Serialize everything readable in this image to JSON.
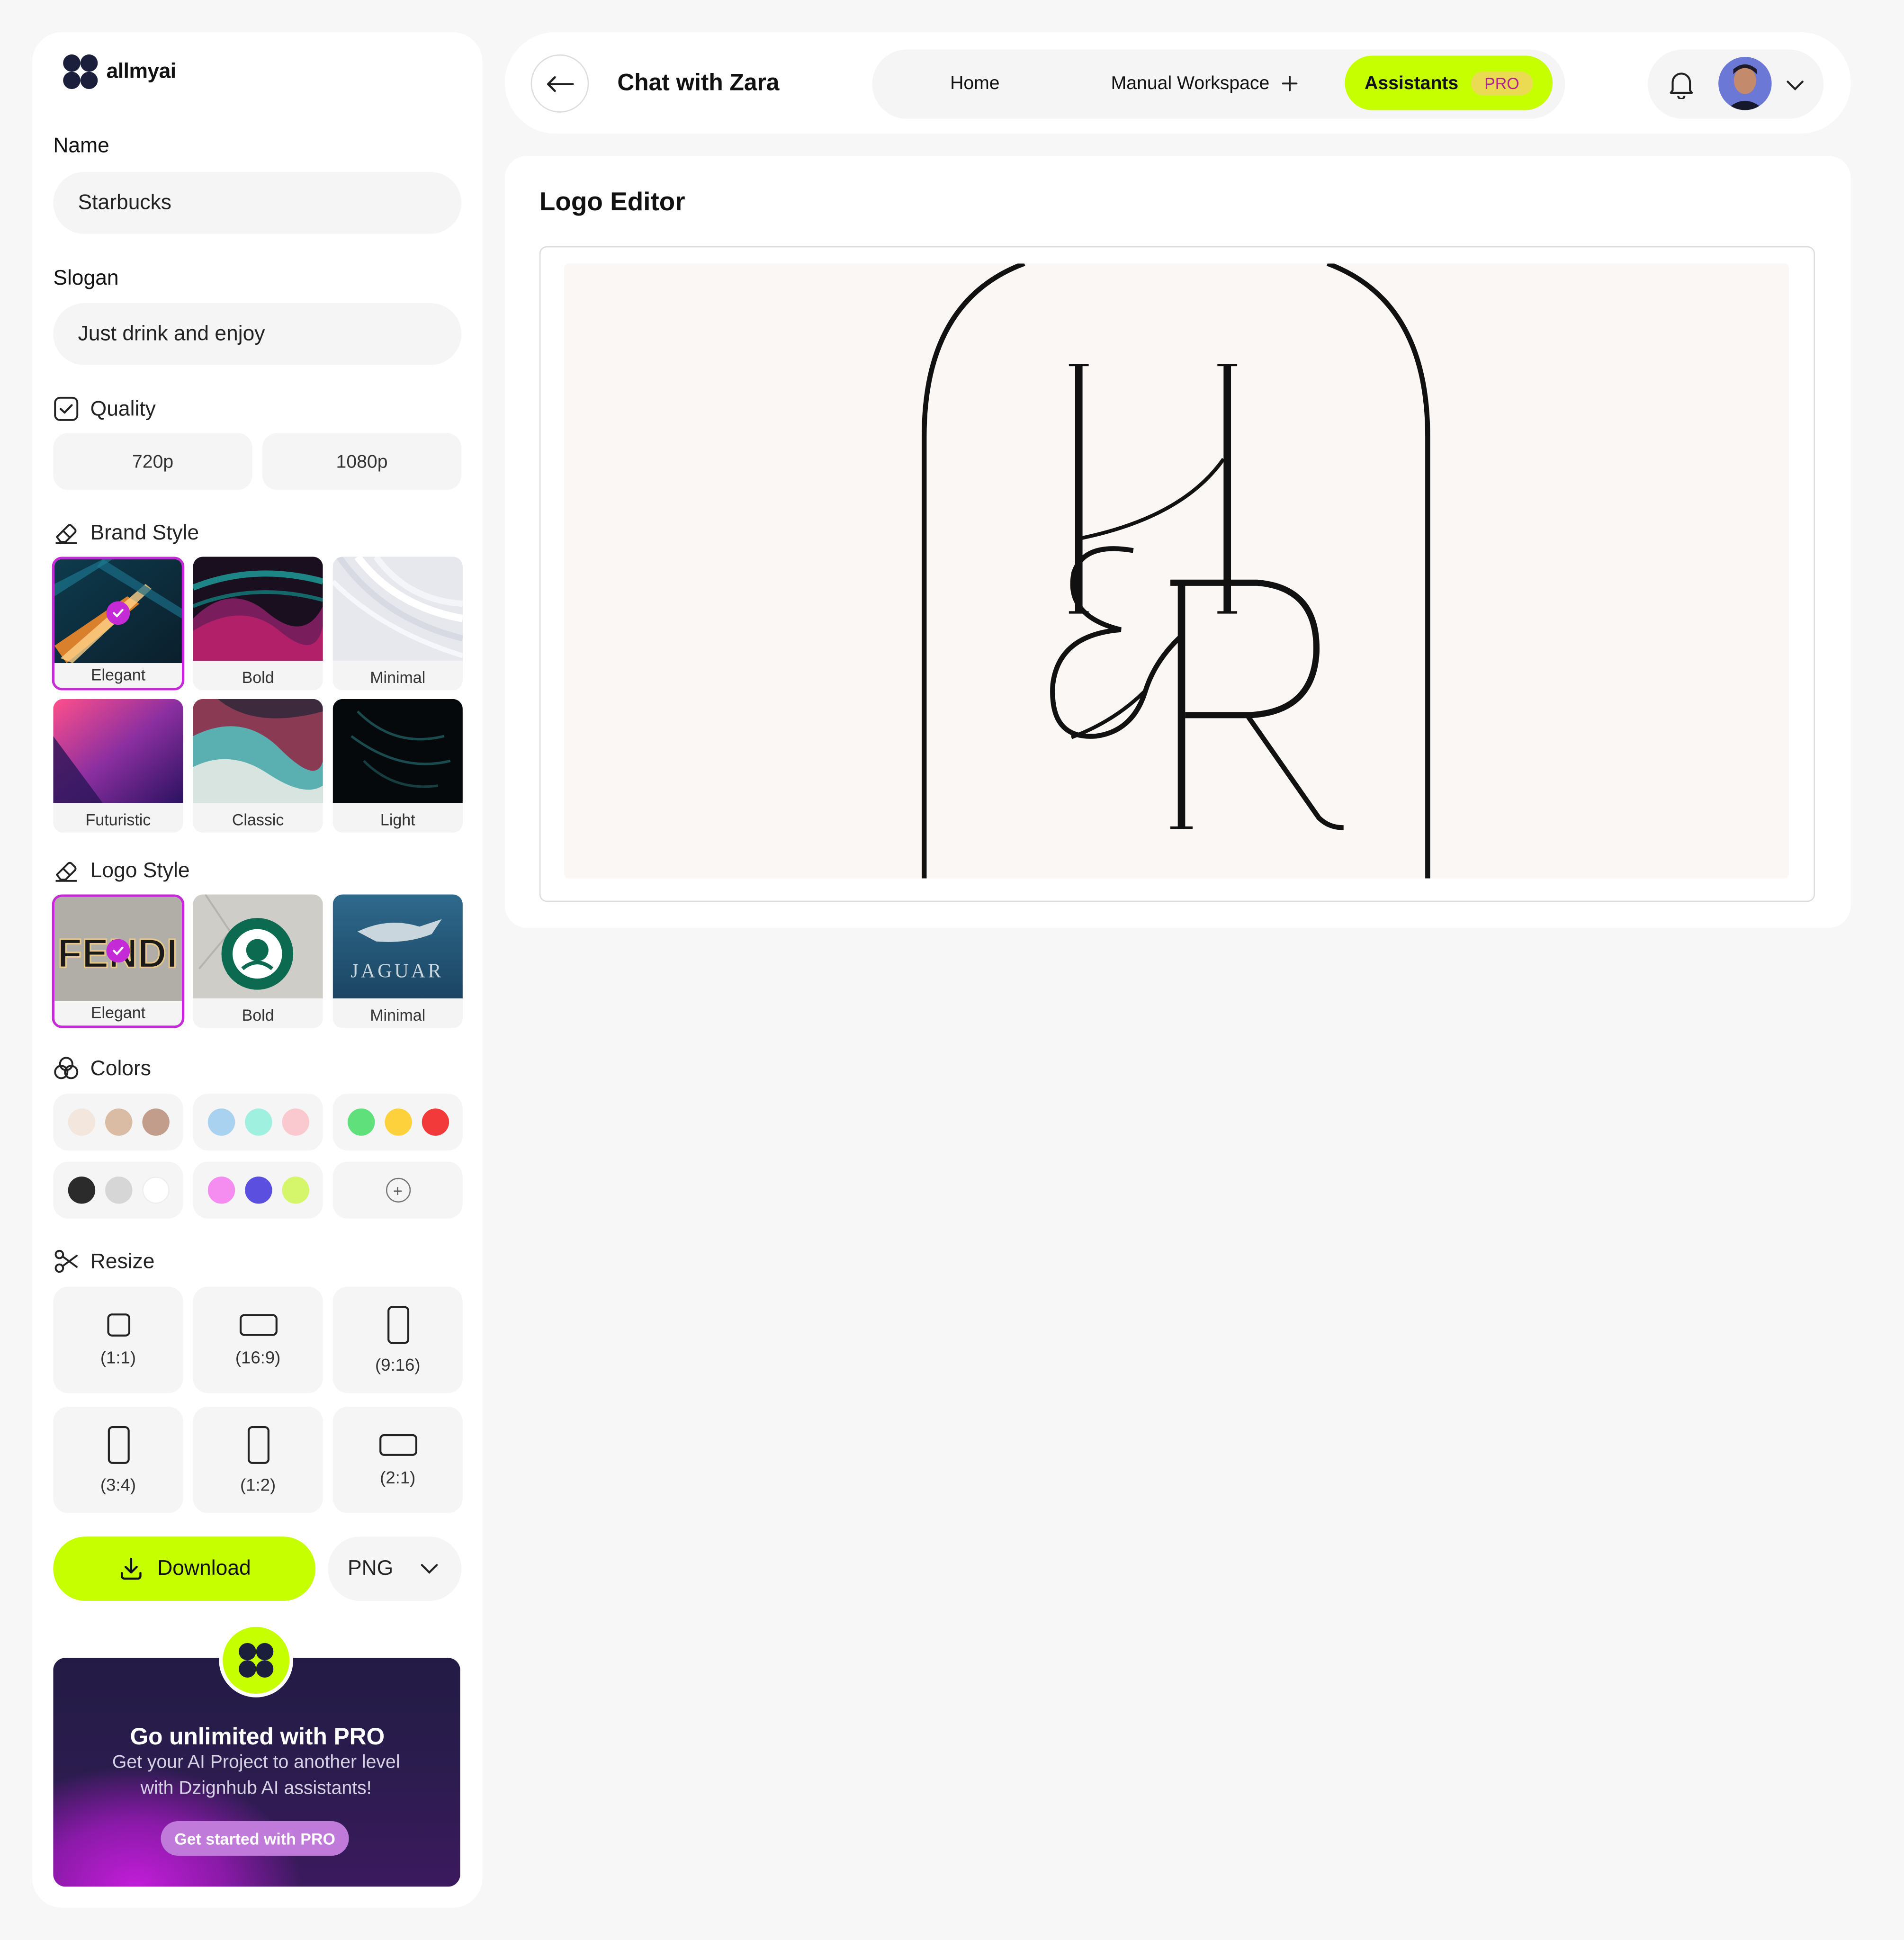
{
  "brand": {
    "name": "allmyai"
  },
  "form": {
    "name_label": "Name",
    "name_value": "Starbucks",
    "slogan_label": "Slogan",
    "slogan_value": "Just drink and enjoy"
  },
  "quality": {
    "title": "Quality",
    "options": [
      "720p",
      "1080p"
    ]
  },
  "brand_style": {
    "title": "Brand Style",
    "selected": "Elegant",
    "tiles": [
      "Elegant",
      "Bold",
      "Minimal",
      "Futuristic",
      "Classic",
      "Light"
    ]
  },
  "logo_style": {
    "title": "Logo Style",
    "selected": "Elegant",
    "tiles": [
      "Elegant",
      "Bold",
      "Minimal"
    ],
    "tile_text": [
      "FENDI",
      "JAGUAR"
    ]
  },
  "colors": {
    "title": "Colors",
    "groups": [
      [
        "#f3e6dc",
        "#d9bca3",
        "#c29d8b"
      ],
      [
        "#a9d1f0",
        "#9ff0df",
        "#f9c9cf"
      ],
      [
        "#5fe07a",
        "#fdd13b",
        "#f33a3a"
      ],
      [
        "#2b2b2b",
        "#d6d6d6",
        "#ffffff"
      ],
      [
        "#f58cf0",
        "#5b4fe0",
        "#d5f56a"
      ]
    ],
    "add_symbol": "+"
  },
  "resize": {
    "title": "Resize",
    "options": [
      "(1:1)",
      "(16:9)",
      "(9:16)",
      "(3:4)",
      "(1:2)",
      "(2:1)"
    ]
  },
  "actions": {
    "download_label": "Download",
    "format_value": "PNG"
  },
  "promo": {
    "title": "Go unlimited with PRO",
    "text_line1": "Get your AI Project to another level",
    "text_line2": "with Dzignhub AI assistants!",
    "cta": "Get started with PRO"
  },
  "header": {
    "title": "Chat with Zara",
    "nav": {
      "home": "Home",
      "workspace": "Manual Workspace",
      "assistants": "Assistants",
      "pro_badge": "PRO"
    }
  },
  "editor": {
    "title": "Logo Editor"
  },
  "theme": {
    "accent": "#c6ff00",
    "selection": "#c42ad6"
  }
}
